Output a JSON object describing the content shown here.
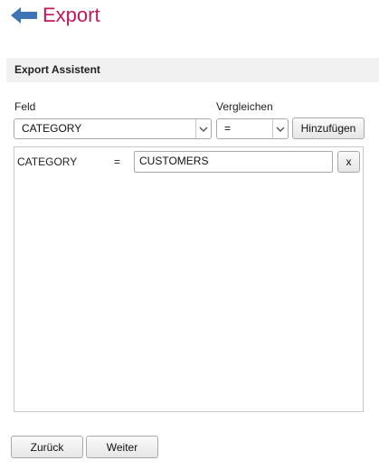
{
  "header": {
    "title": "Export"
  },
  "section": {
    "title": "Export Assistent"
  },
  "form": {
    "field_label": "Feld",
    "field_value": "CATEGORY",
    "compare_label": "Vergleichen",
    "compare_value": "=",
    "add_label": "Hinzufügen"
  },
  "conditions": [
    {
      "field": "CATEGORY",
      "operator": "=",
      "value": "CUSTOMERS",
      "remove_label": "x"
    }
  ],
  "footer": {
    "back_label": "Zurück",
    "next_label": "Weiter"
  }
}
